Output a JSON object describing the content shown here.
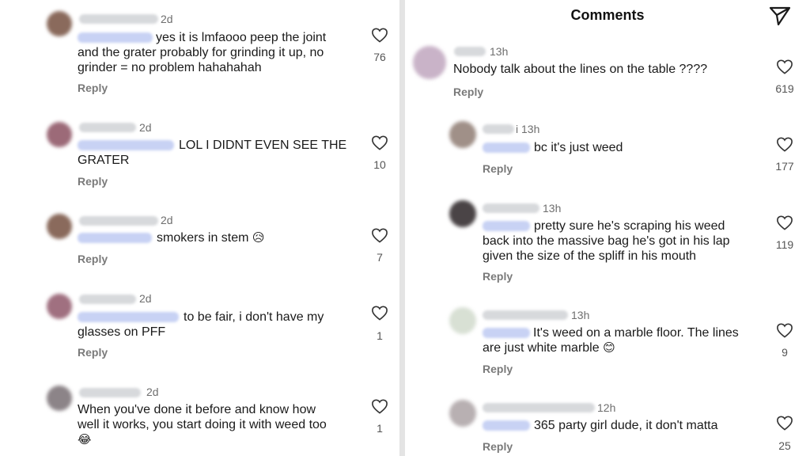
{
  "right_header": {
    "title": "Comments",
    "send_icon": "paper-plane-icon"
  },
  "left_comments": [
    {
      "time": "2d",
      "text": "yes it is lmfaooo peep the joint and the grater probably for grinding it up, no grinder = no problem hahahahah",
      "line1": "yes it is lmfaooo peep the joint",
      "line2": "and the grater probably for grinding it up, no",
      "line3": "grinder = no problem hahahahah",
      "reply": "Reply",
      "likes": "76",
      "avatar_color": "#8a6a5c"
    },
    {
      "time": "2d",
      "line1": "LOL I DIDNT EVEN SEE THE",
      "line2": "GRATER",
      "reply": "Reply",
      "likes": "10",
      "avatar_color": "#9c6a78"
    },
    {
      "time": "2d",
      "line1": "smokers in stem",
      "emoji": "😥",
      "reply": "Reply",
      "likes": "7",
      "avatar_color": "#8a6a5c"
    },
    {
      "time": "2d",
      "line1": "to be fair, i don't have my",
      "line2": "glasses on PFF",
      "reply": "Reply",
      "likes": "1",
      "avatar_color": "#a07080"
    },
    {
      "time": "2d",
      "line1": "When you've done it before and know how",
      "line2": "well it works, you start doing it with weed too",
      "emoji": "😂",
      "likes": "1",
      "avatar_color": "#8c8488"
    }
  ],
  "right_comments": [
    {
      "time": "13h",
      "line1": "Nobody talk about the lines on the table ????",
      "reply": "Reply",
      "likes": "619",
      "avatar_color": "#c9b3c8"
    },
    {
      "time": "i 13h",
      "line1": "bc it's just weed",
      "reply": "Reply",
      "likes": "177",
      "avatar_color": "#a09088"
    },
    {
      "time": "13h",
      "line1": "pretty sure he's scraping his weed",
      "line2": "back into the massive bag he's got in his lap",
      "line3": "given the size of the spliff in his mouth",
      "reply": "Reply",
      "likes": "119",
      "avatar_color": "#4a4446"
    },
    {
      "time": "13h",
      "line1": "It's weed on a marble floor. The lines",
      "line2": "are just white marble",
      "emoji": "😊",
      "reply": "Reply",
      "likes": "9",
      "avatar_color": "#d8e0d4"
    },
    {
      "time": "12h",
      "line1": "365 party girl dude, it don't matta",
      "reply": "Reply",
      "likes": "25",
      "avatar_color": "#b8b0b2"
    }
  ]
}
